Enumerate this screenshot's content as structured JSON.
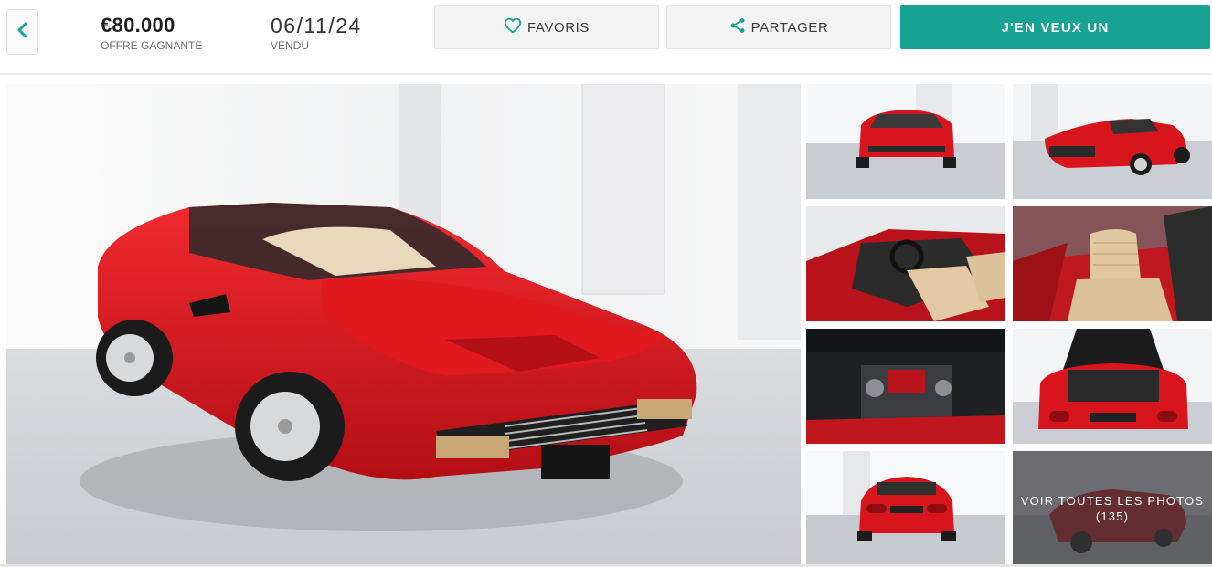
{
  "header": {
    "back_icon": "chevron-left-icon",
    "price": "€80.000",
    "price_label": "OFFRE GAGNANTE",
    "date": "06/11/24",
    "date_label": "VENDU",
    "favorite_label": "FAVORIS",
    "favorite_icon": "heart-icon",
    "share_label": "PARTAGER",
    "share_icon": "share-icon",
    "cta_label": "J'EN VEUX UN"
  },
  "gallery": {
    "more_label": "VOIR TOUTES LES PHOTOS",
    "photo_count": "(135)"
  },
  "colors": {
    "accent": "#16a393",
    "car_red": "#d8141c"
  }
}
